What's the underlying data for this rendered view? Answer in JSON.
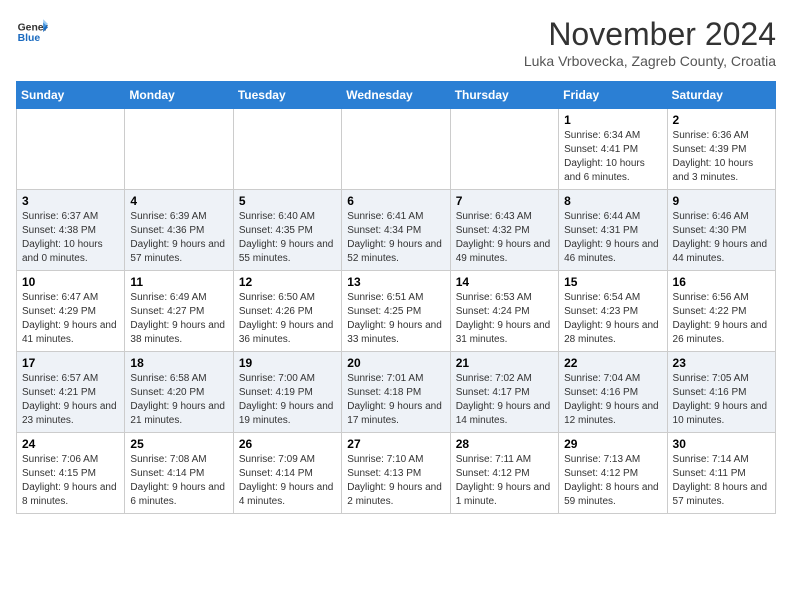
{
  "header": {
    "title": "November 2024",
    "subtitle": "Luka Vrbovecka, Zagreb County, Croatia"
  },
  "logo": {
    "general": "General",
    "blue": "Blue"
  },
  "weekdays": [
    "Sunday",
    "Monday",
    "Tuesday",
    "Wednesday",
    "Thursday",
    "Friday",
    "Saturday"
  ],
  "weeks": [
    {
      "days": [
        {
          "date": "",
          "info": ""
        },
        {
          "date": "",
          "info": ""
        },
        {
          "date": "",
          "info": ""
        },
        {
          "date": "",
          "info": ""
        },
        {
          "date": "",
          "info": ""
        },
        {
          "date": "1",
          "info": "Sunrise: 6:34 AM\nSunset: 4:41 PM\nDaylight: 10 hours and 6 minutes."
        },
        {
          "date": "2",
          "info": "Sunrise: 6:36 AM\nSunset: 4:39 PM\nDaylight: 10 hours and 3 minutes."
        }
      ]
    },
    {
      "days": [
        {
          "date": "3",
          "info": "Sunrise: 6:37 AM\nSunset: 4:38 PM\nDaylight: 10 hours and 0 minutes."
        },
        {
          "date": "4",
          "info": "Sunrise: 6:39 AM\nSunset: 4:36 PM\nDaylight: 9 hours and 57 minutes."
        },
        {
          "date": "5",
          "info": "Sunrise: 6:40 AM\nSunset: 4:35 PM\nDaylight: 9 hours and 55 minutes."
        },
        {
          "date": "6",
          "info": "Sunrise: 6:41 AM\nSunset: 4:34 PM\nDaylight: 9 hours and 52 minutes."
        },
        {
          "date": "7",
          "info": "Sunrise: 6:43 AM\nSunset: 4:32 PM\nDaylight: 9 hours and 49 minutes."
        },
        {
          "date": "8",
          "info": "Sunrise: 6:44 AM\nSunset: 4:31 PM\nDaylight: 9 hours and 46 minutes."
        },
        {
          "date": "9",
          "info": "Sunrise: 6:46 AM\nSunset: 4:30 PM\nDaylight: 9 hours and 44 minutes."
        }
      ]
    },
    {
      "days": [
        {
          "date": "10",
          "info": "Sunrise: 6:47 AM\nSunset: 4:29 PM\nDaylight: 9 hours and 41 minutes."
        },
        {
          "date": "11",
          "info": "Sunrise: 6:49 AM\nSunset: 4:27 PM\nDaylight: 9 hours and 38 minutes."
        },
        {
          "date": "12",
          "info": "Sunrise: 6:50 AM\nSunset: 4:26 PM\nDaylight: 9 hours and 36 minutes."
        },
        {
          "date": "13",
          "info": "Sunrise: 6:51 AM\nSunset: 4:25 PM\nDaylight: 9 hours and 33 minutes."
        },
        {
          "date": "14",
          "info": "Sunrise: 6:53 AM\nSunset: 4:24 PM\nDaylight: 9 hours and 31 minutes."
        },
        {
          "date": "15",
          "info": "Sunrise: 6:54 AM\nSunset: 4:23 PM\nDaylight: 9 hours and 28 minutes."
        },
        {
          "date": "16",
          "info": "Sunrise: 6:56 AM\nSunset: 4:22 PM\nDaylight: 9 hours and 26 minutes."
        }
      ]
    },
    {
      "days": [
        {
          "date": "17",
          "info": "Sunrise: 6:57 AM\nSunset: 4:21 PM\nDaylight: 9 hours and 23 minutes."
        },
        {
          "date": "18",
          "info": "Sunrise: 6:58 AM\nSunset: 4:20 PM\nDaylight: 9 hours and 21 minutes."
        },
        {
          "date": "19",
          "info": "Sunrise: 7:00 AM\nSunset: 4:19 PM\nDaylight: 9 hours and 19 minutes."
        },
        {
          "date": "20",
          "info": "Sunrise: 7:01 AM\nSunset: 4:18 PM\nDaylight: 9 hours and 17 minutes."
        },
        {
          "date": "21",
          "info": "Sunrise: 7:02 AM\nSunset: 4:17 PM\nDaylight: 9 hours and 14 minutes."
        },
        {
          "date": "22",
          "info": "Sunrise: 7:04 AM\nSunset: 4:16 PM\nDaylight: 9 hours and 12 minutes."
        },
        {
          "date": "23",
          "info": "Sunrise: 7:05 AM\nSunset: 4:16 PM\nDaylight: 9 hours and 10 minutes."
        }
      ]
    },
    {
      "days": [
        {
          "date": "24",
          "info": "Sunrise: 7:06 AM\nSunset: 4:15 PM\nDaylight: 9 hours and 8 minutes."
        },
        {
          "date": "25",
          "info": "Sunrise: 7:08 AM\nSunset: 4:14 PM\nDaylight: 9 hours and 6 minutes."
        },
        {
          "date": "26",
          "info": "Sunrise: 7:09 AM\nSunset: 4:14 PM\nDaylight: 9 hours and 4 minutes."
        },
        {
          "date": "27",
          "info": "Sunrise: 7:10 AM\nSunset: 4:13 PM\nDaylight: 9 hours and 2 minutes."
        },
        {
          "date": "28",
          "info": "Sunrise: 7:11 AM\nSunset: 4:12 PM\nDaylight: 9 hours and 1 minute."
        },
        {
          "date": "29",
          "info": "Sunrise: 7:13 AM\nSunset: 4:12 PM\nDaylight: 8 hours and 59 minutes."
        },
        {
          "date": "30",
          "info": "Sunrise: 7:14 AM\nSunset: 4:11 PM\nDaylight: 8 hours and 57 minutes."
        }
      ]
    }
  ]
}
